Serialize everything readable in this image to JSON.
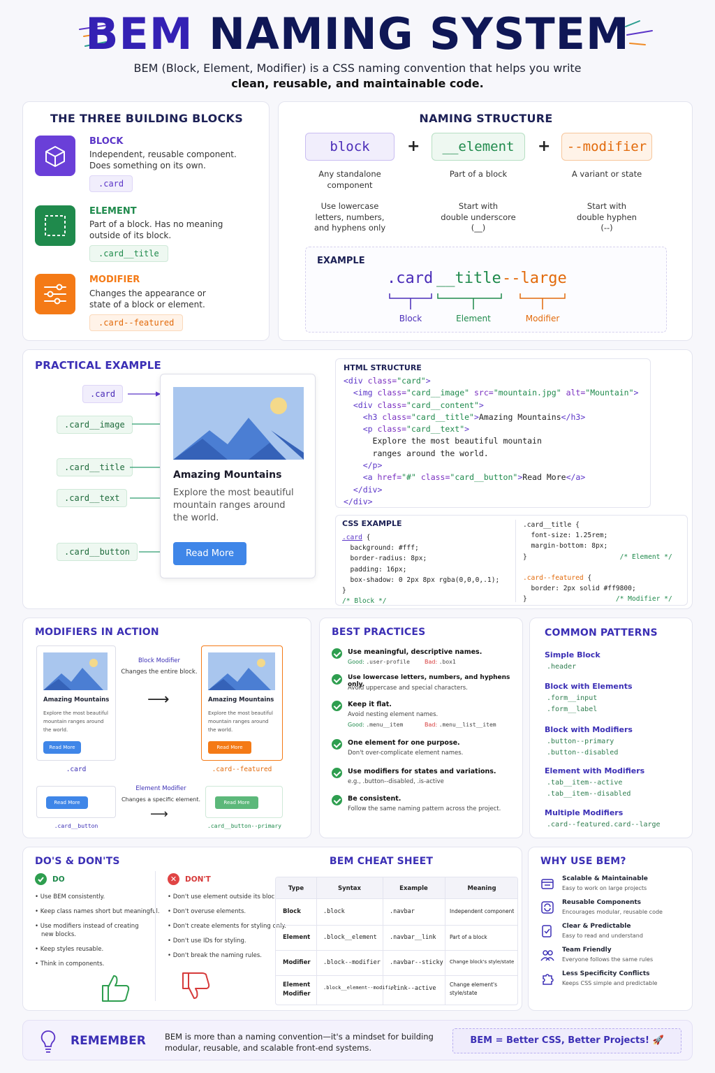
{
  "header": {
    "title_part1": "BEM",
    "title_part2": "NAMING SYSTEM",
    "subtitle": "BEM (Block, Element, Modifier) is a CSS naming convention that helps you write",
    "subtitle_bold": "clean, reusable, and maintainable code."
  },
  "building_blocks": {
    "title": "THE THREE BUILDING BLOCKS",
    "items": [
      {
        "name": "BLOCK",
        "desc1": "Independent, reusable component.",
        "desc2": "Does something on its own.",
        "example": ".card",
        "icon": "cube-icon",
        "color": "#6a3fd8"
      },
      {
        "name": "ELEMENT",
        "desc1": "Part of a block. Has no meaning",
        "desc2": "outside of its block.",
        "example": ".card__title",
        "icon": "dashed-square-icon",
        "color": "#1f8a4c"
      },
      {
        "name": "MODIFIER",
        "desc1": "Changes the appearance or",
        "desc2": "state of a block or element.",
        "example": ".card--featured",
        "icon": "sliders-icon",
        "color": "#f47a16"
      }
    ]
  },
  "naming_structure": {
    "title": "NAMING STRUCTURE",
    "boxes": [
      {
        "label": "block",
        "desc": "Any standalone component",
        "rule1": "Use lowercase",
        "rule2": "letters, numbers,",
        "rule3": "and hyphens only"
      },
      {
        "label": "__element",
        "desc": "Part of a block",
        "rule1": "Start with",
        "rule2": "double underscore",
        "rule3": "(__)"
      },
      {
        "label": "--modifier",
        "desc": "A variant or state",
        "rule1": "Start with",
        "rule2": "double hyphen",
        "rule3": "(--)"
      }
    ],
    "example_title": "EXAMPLE",
    "example_block": ".card",
    "example_element": "__title",
    "example_modifier": "--large",
    "label_block": "Block",
    "label_element": "Element",
    "label_modifier": "Modifier"
  },
  "practical": {
    "title": "PRACTICAL EXAMPLE",
    "labels": [
      ".card",
      ".card__image",
      ".card__title",
      ".card__text",
      ".card__button"
    ],
    "card_title": "Amazing Mountains",
    "card_text1": "Explore the most beautiful",
    "card_text2": "mountain ranges around",
    "card_text3": "the world.",
    "card_button": "Read More",
    "html_title": "HTML STRUCTURE",
    "css_title": "CSS EXAMPLE"
  },
  "modifiers_in_action": {
    "title": "MODIFIERS IN ACTION",
    "block_modifier_title": "Block Modifier",
    "block_modifier_desc": "Changes the entire block.",
    "element_modifier_title": "Element Modifier",
    "element_modifier_desc": "Changes a specific element.",
    "card_title": "Amazing Mountains",
    "card_text1": "Explore the most beautiful",
    "card_text2": "mountain ranges around",
    "card_text3": "the world.",
    "button": "Read More",
    "label_card": ".card",
    "label_featured": ".card--featured",
    "label_button": ".card__button",
    "label_primary": ".card__button--primary"
  },
  "best_practices": {
    "title": "BEST PRACTICES",
    "items": [
      {
        "title": "Use meaningful, descriptive names.",
        "sub": "",
        "good": ".user-profile",
        "bad": ".box1"
      },
      {
        "title": "Use lowercase letters, numbers, and hyphens only.",
        "sub": "Avoid uppercase and special characters."
      },
      {
        "title": "Keep it flat.",
        "sub": "Avoid nesting element names.",
        "good": ".menu__item",
        "bad": ".menu__list__item"
      },
      {
        "title": "One element for one purpose.",
        "sub": "Don't over-complicate element names."
      },
      {
        "title": "Use modifiers for states and variations.",
        "sub": "e.g., .button--disabled, .is-active"
      },
      {
        "title": "Be consistent.",
        "sub": "Follow the same naming pattern across the project."
      }
    ],
    "good_label": "Good:",
    "bad_label": "Bad:"
  },
  "common_patterns": {
    "title": "COMMON PATTERNS",
    "groups": [
      {
        "name": "Simple Block",
        "codes": [
          ".header"
        ]
      },
      {
        "name": "Block with Elements",
        "codes": [
          ".form__input",
          ".form__label"
        ]
      },
      {
        "name": "Block with Modifiers",
        "codes": [
          ".button--primary",
          ".button--disabled"
        ]
      },
      {
        "name": "Element with Modifiers",
        "codes": [
          ".tab__item--active",
          ".tab__item--disabled"
        ]
      },
      {
        "name": "Multiple Modifiers",
        "codes": [
          ".card--featured.card--large"
        ]
      }
    ]
  },
  "dos_donts": {
    "title": "DO'S & DON'TS",
    "do_label": "DO",
    "dont_label": "DON'T",
    "dos": [
      "Use BEM consistently.",
      "Keep class names short but meaningful.",
      "Use modifiers instead of creating",
      "new blocks.",
      "Keep styles reusable.",
      "Think in components."
    ],
    "donts": [
      "Don't use element outside its block.",
      "Don't overuse elements.",
      "Don't create elements for styling only.",
      "Don't use IDs for styling.",
      "Don't break the naming rules."
    ]
  },
  "cheat_sheet": {
    "title": "BEM CHEAT SHEET",
    "headers": [
      "Type",
      "Syntax",
      "Example",
      "Meaning"
    ],
    "rows": [
      [
        "Block",
        ".block",
        ".navbar",
        "Independent component"
      ],
      [
        "Element",
        ".block__element",
        ".navbar__link",
        "Part of a block"
      ],
      [
        "Modifier",
        ".block--modifier",
        ".navbar--sticky",
        "Change block's style/state"
      ],
      [
        "Element Modifier",
        ".block__element--modifier",
        ".link--active",
        "Change element's style/state"
      ]
    ]
  },
  "why": {
    "title": "WHY USE BEM?",
    "items": [
      {
        "title": "Scalable & Maintainable",
        "sub": "Easy to work on large projects"
      },
      {
        "title": "Reusable Components",
        "sub": "Encourages modular, reusable code"
      },
      {
        "title": "Clear & Predictable",
        "sub": "Easy to read and understand"
      },
      {
        "title": "Team Friendly",
        "sub": "Everyone follows the same rules"
      },
      {
        "title": "Less Specificity Conflicts",
        "sub": "Keeps CSS simple and predictable"
      }
    ]
  },
  "remember": {
    "title": "REMEMBER",
    "text1": "BEM is more than a naming convention—it's a mindset for building",
    "text2": "modular, reusable, and scalable front-end systems.",
    "badge": "BEM = Better CSS, Better Projects! 🚀"
  }
}
